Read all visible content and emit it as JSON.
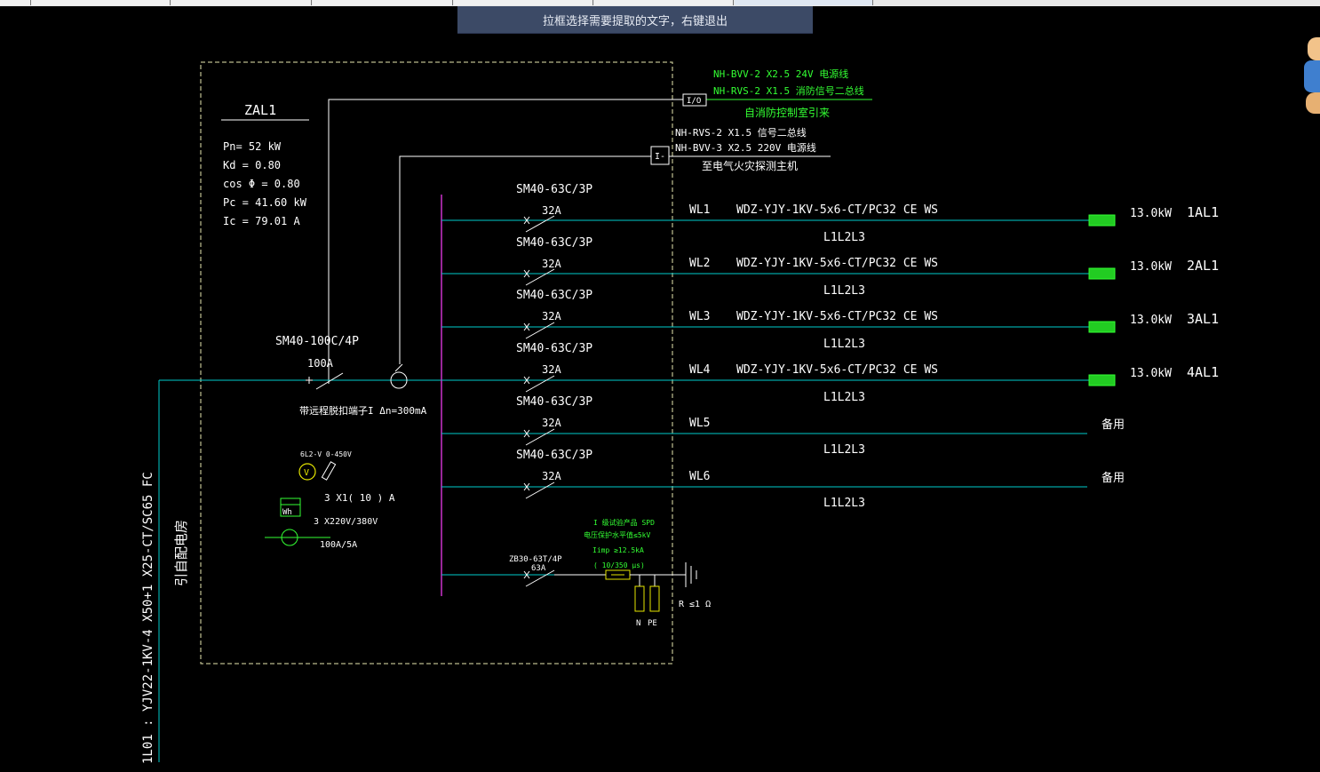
{
  "toolbar": {
    "tabs": [
      "",
      "",
      "",
      "",
      "",
      ""
    ]
  },
  "banner": {
    "text": "拉框选择需要提取的文字，右键退出"
  },
  "panel": {
    "name": "ZAL1",
    "params": [
      "Pn=  52  kW",
      "Kd  =  0.80",
      "cos  Φ  =  0.80",
      "Pc  =  41.60    kW",
      "Ic  =  79.01    A"
    ]
  },
  "fire_control": {
    "line1": "NH-BVV-2      X2.5   24V  电源线",
    "line2": "NH-RVS-2      X1.5   消防信号二总线",
    "io_label": "I/O",
    "from_text": "自消防控制室引来"
  },
  "fire_alarm": {
    "line1": "NH-RVS-2      X1.5    信号二总线",
    "line2": "NH-BVV-3     X2.5    220V   电源线",
    "box_label": "I-",
    "to_text": "至电气火灾探测主机"
  },
  "main_breaker": {
    "model": "SM40-100C/4P",
    "rating": "100A",
    "note": "带远程脱扣端子I Δn=300mA"
  },
  "incoming": {
    "vertical_text": "1L01 : YJV22-1KV-4  X50+1   X25-CT/SC65   FC",
    "source_text": "引自配电房"
  },
  "meters": {
    "voltmeter_label": "6L2-V 0-450V",
    "voltmeter_symbol": "V",
    "ct_text": "3 X1( 10 ) A",
    "wh_symbol": "Wh",
    "wh_text": "3 X220V/380V",
    "ratio_text": "100A/5A"
  },
  "circuits": [
    {
      "breaker": "SM40-63C/3P",
      "rating": "32A",
      "id": "WL1",
      "cable": "WDZ-YJY-1KV-5x6-CT/PC32 CE WS",
      "phases": "L1L2L3",
      "power": "13.0kW",
      "dest": "1AL1",
      "spare": ""
    },
    {
      "breaker": "SM40-63C/3P",
      "rating": "32A",
      "id": "WL2",
      "cable": "WDZ-YJY-1KV-5x6-CT/PC32 CE WS",
      "phases": "L1L2L3",
      "power": "13.0kW",
      "dest": "2AL1",
      "spare": ""
    },
    {
      "breaker": "SM40-63C/3P",
      "rating": "32A",
      "id": "WL3",
      "cable": "WDZ-YJY-1KV-5x6-CT/PC32 CE WS",
      "phases": "L1L2L3",
      "power": "13.0kW",
      "dest": "3AL1",
      "spare": ""
    },
    {
      "breaker": "SM40-63C/3P",
      "rating": "32A",
      "id": "WL4",
      "cable": "WDZ-YJY-1KV-5x6-CT/PC32 CE WS",
      "phases": "L1L2L3",
      "power": "13.0kW",
      "dest": "4AL1",
      "spare": ""
    },
    {
      "breaker": "SM40-63C/3P",
      "rating": "32A",
      "id": "WL5",
      "cable": "",
      "phases": "L1L2L3",
      "power": "",
      "dest": "",
      "spare": "备用"
    },
    {
      "breaker": "SM40-63C/3P",
      "rating": "32A",
      "id": "WL6",
      "cable": "",
      "phases": "L1L2L3",
      "power": "",
      "dest": "",
      "spare": "备用"
    }
  ],
  "spd": {
    "breaker": "ZB30-63T/4P",
    "rating": "63A",
    "line1": "I 级试验产品 SPD",
    "line2": "电压保护水平值≤5kV",
    "line3": "Iimp  ≥12.5kA",
    "line4": "( 10/350     μs)",
    "n_label": "N",
    "pe_label": "PE",
    "r_label": "R ≤1 Ω"
  },
  "colors": {
    "background": "#000000",
    "white_lines": "#ffffff",
    "cyan_lines": "#00cccc",
    "busbar": "#cc33cc",
    "fire_green": "#33ff33",
    "banner_bg": "#3c4a66"
  }
}
